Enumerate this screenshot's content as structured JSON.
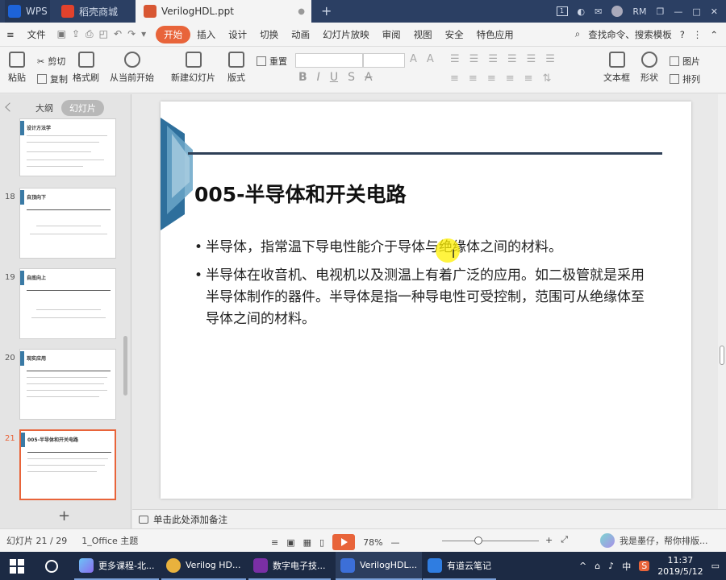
{
  "titlebar": {
    "tabs": [
      {
        "label": "WPS",
        "icon": "wps-logo-icon"
      },
      {
        "label": "稻壳商城",
        "icon": "docer-icon"
      },
      {
        "label": "VerilogHDL.ppt",
        "icon": "ppt-file-icon"
      }
    ],
    "page_badge": "1",
    "user": "RM"
  },
  "menubar": {
    "file_label": "文件",
    "items": [
      "开始",
      "插入",
      "设计",
      "切换",
      "动画",
      "幻灯片放映",
      "审阅",
      "视图",
      "安全",
      "特色应用"
    ],
    "search_label": "查找命令、搜索模板"
  },
  "ribbon": {
    "paste": "粘贴",
    "cut": "剪切",
    "copy": "复制",
    "format_painter": "格式刷",
    "from_current": "从当前开始",
    "new_slide": "新建幻灯片",
    "layout": "版式",
    "reset": "重置",
    "textbox": "文本框",
    "shape": "形状",
    "picture": "图片",
    "arrange": "排列"
  },
  "left_panel": {
    "tabs": [
      "大纲",
      "幻灯片"
    ],
    "thumbnails": [
      {
        "num": "",
        "title": "设计方法学"
      },
      {
        "num": "18",
        "title": "自顶向下"
      },
      {
        "num": "19",
        "title": "自底向上"
      },
      {
        "num": "20",
        "title": "现实应用"
      },
      {
        "num": "21",
        "title": "005-半导体和开关电路"
      }
    ]
  },
  "slide": {
    "title": "005-半导体和开关电路",
    "bullets": [
      "半导体，指常温下导电性能介于导体与绝缘体之间的材料。",
      "半导体在收音机、电视机以及测温上有着广泛的应用。如二极管就是采用半导体制作的器件。半导体是指一种导电性可受控制，范围可从绝缘体至导体之间的材料。"
    ]
  },
  "notes": {
    "placeholder": "单击此处添加备注"
  },
  "statusbar": {
    "slide_counter": "幻灯片 21 / 29",
    "theme": "1_Office 主题",
    "zoom": "78%",
    "assistant": "我是墨仔，帮你排版..."
  },
  "taskbar": {
    "tasks": [
      "更多课程-北...",
      "Verilog HD...",
      "数字电子技...",
      "VerilogHDL...",
      "有道云笔记"
    ],
    "ime": "中",
    "time": "11:37",
    "date": "2019/5/12"
  },
  "colors": {
    "accent": "#e8643a",
    "titlebar": "#2b3f63",
    "slide_dark": "#2e3f56",
    "slide_blue": "#3a7aa5"
  }
}
